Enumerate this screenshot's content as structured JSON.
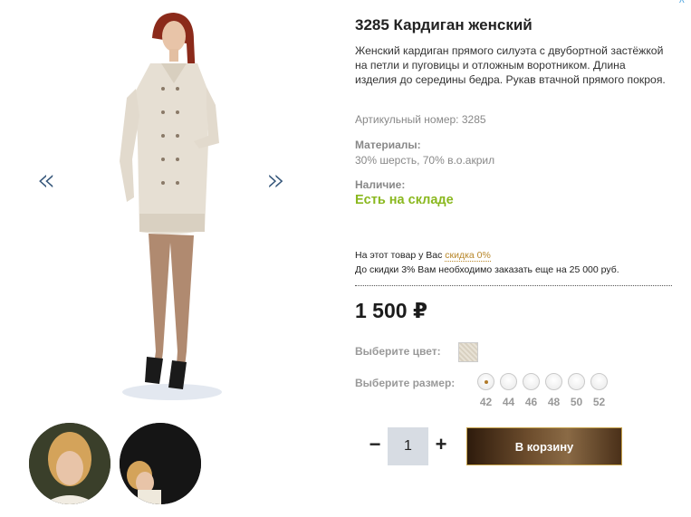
{
  "gallery": {
    "prev_label": "«",
    "next_label": "»"
  },
  "product": {
    "title": "3285 Кардиган женский",
    "description": "Женский кардиган прямого силуэта с двубортной застёжкой на петли и пуговицы и отложным воротником. Длина изделия до середины бедра. Рукав втачной прямого покроя.",
    "article": "Артикульный номер: 3285",
    "materials_label": "Материалы:",
    "materials_value": "30% шерсть, 70% в.о.акрил",
    "availability_label": "Наличие:",
    "availability_value": "Есть на складе",
    "availability_color": "#8ab81f"
  },
  "discount": {
    "line1_prefix": "На этот товар у Вас",
    "line1_link": "скидка 0%",
    "line2": "До скидки 3% Вам необходимо заказать еще на 25 000 руб."
  },
  "price": {
    "value": "1 500 ₽"
  },
  "color": {
    "label": "Выберите цвет:"
  },
  "size": {
    "label": "Выберите размер:",
    "options": [
      "42",
      "44",
      "46",
      "48",
      "50",
      "52"
    ],
    "selected": "42"
  },
  "quantity": {
    "minus": "−",
    "value": "1",
    "plus": "+"
  },
  "cart": {
    "button_label": "В корзину",
    "accent": "#c6a24a"
  }
}
